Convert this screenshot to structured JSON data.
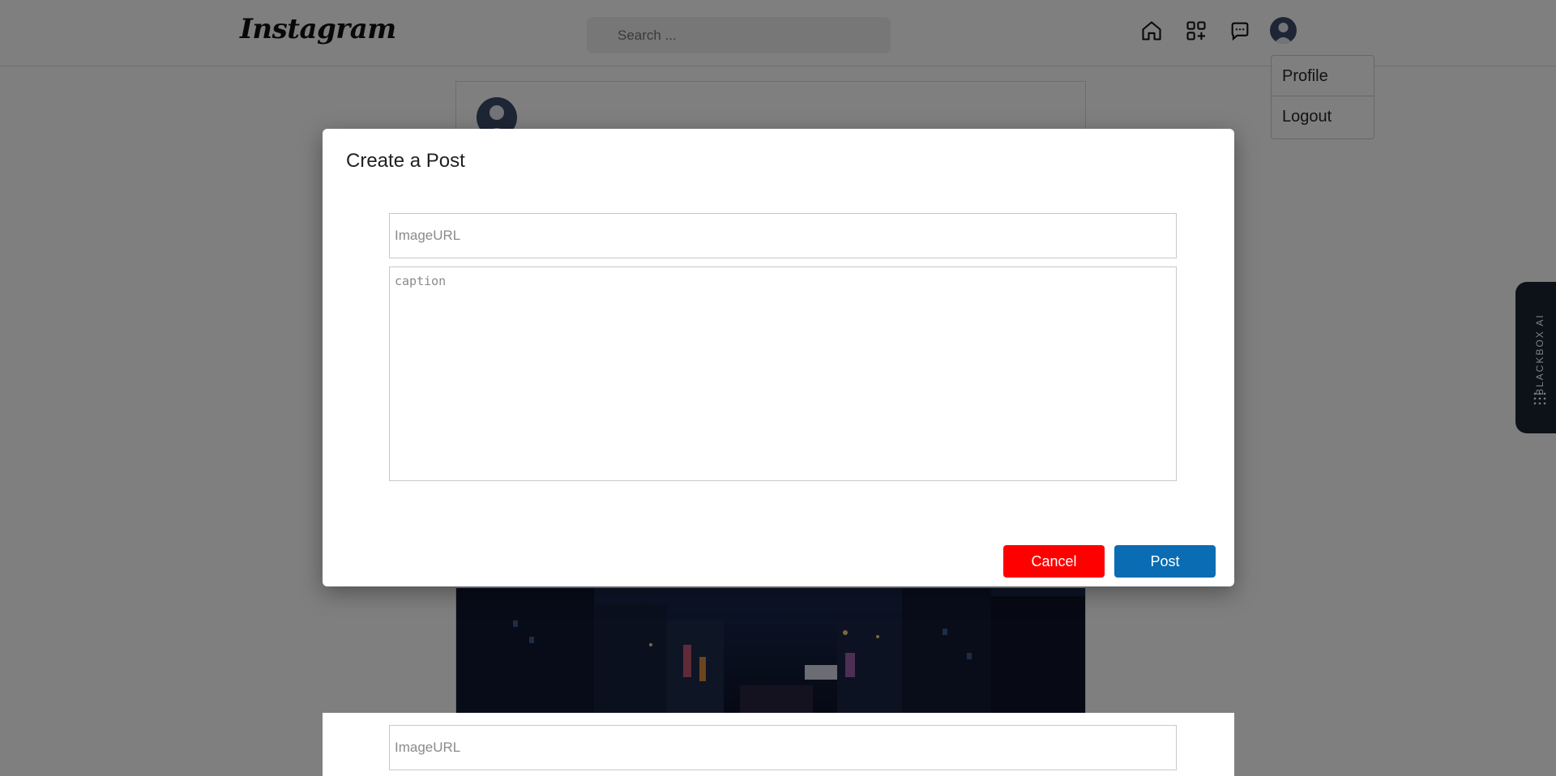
{
  "nav": {
    "logo": "Instagram",
    "search_placeholder": "Search ...",
    "icons": [
      "home-icon",
      "add-post-icon",
      "messages-icon",
      "profile-avatar"
    ]
  },
  "dropdown": {
    "items": [
      {
        "label": "Profile"
      },
      {
        "label": "Logout"
      }
    ]
  },
  "side_widget": {
    "label": "BLACKBOX AI"
  },
  "modal": {
    "title": "Create a Post",
    "image_url_placeholder": "ImageURL",
    "caption_placeholder": "caption",
    "cancel_label": "Cancel",
    "post_label": "Post"
  },
  "bottom_panel": {
    "image_url_placeholder": "ImageURL"
  },
  "colors": {
    "cancel": "#ff0000",
    "post": "#0a6cb3",
    "overlay": "rgba(0,0,0,0.5)"
  }
}
